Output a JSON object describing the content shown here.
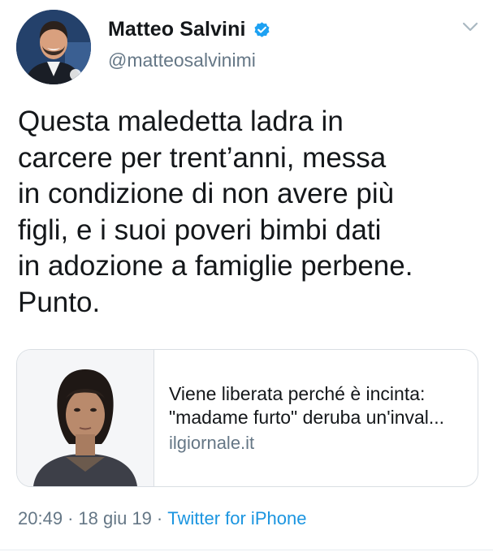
{
  "author": {
    "name": "Matteo Salvini",
    "handle": "@matteosalvinimi",
    "verified": true
  },
  "tweet": {
    "lines": [
      "Questa maledetta ladra in",
      "carcere per trent’anni, messa",
      "in condizione di non avere più",
      "figli, e i suoi poveri bimbi dati",
      "in adozione a famiglie perbene.",
      "Punto."
    ]
  },
  "card": {
    "title_line1": "Viene liberata perché è incinta:",
    "title_line2": "\"madame furto\" deruba un'inval...",
    "domain": "ilgiornale.it"
  },
  "meta": {
    "time": "20:49",
    "date": "18 giu 19",
    "separator": "·",
    "source": "Twitter for iPhone"
  },
  "icons": {
    "verified": "verified-badge-icon",
    "more": "chevron-down-icon"
  },
  "colors": {
    "accent": "#1b95e0",
    "text": "#14171a",
    "secondary": "#657786"
  }
}
